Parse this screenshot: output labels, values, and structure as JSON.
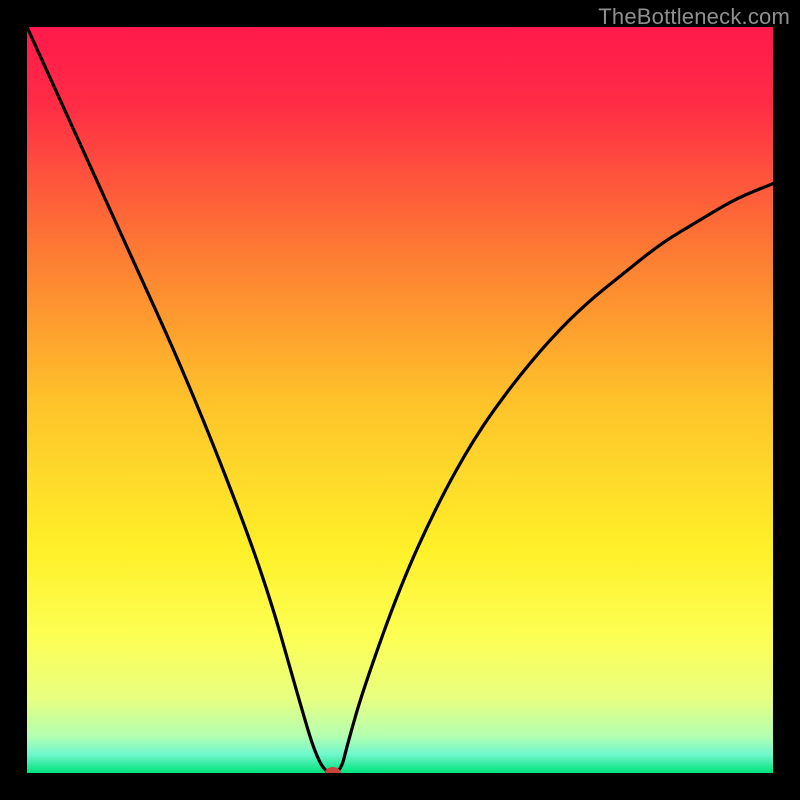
{
  "watermark": "TheBottleneck.com",
  "chart_data": {
    "type": "line",
    "title": "",
    "xlabel": "",
    "ylabel": "",
    "xlim": [
      0,
      100
    ],
    "ylim": [
      0,
      100
    ],
    "grid": false,
    "legend": false,
    "background": {
      "type": "vertical-gradient",
      "stops": [
        {
          "pos": 0.0,
          "color": "#ff1a4b"
        },
        {
          "pos": 0.1,
          "color": "#ff2b46"
        },
        {
          "pos": 0.3,
          "color": "#fd7a33"
        },
        {
          "pos": 0.5,
          "color": "#fec22a"
        },
        {
          "pos": 0.7,
          "color": "#fff029"
        },
        {
          "pos": 0.82,
          "color": "#fcff55"
        },
        {
          "pos": 0.9,
          "color": "#e8ff80"
        },
        {
          "pos": 0.95,
          "color": "#b4ffb0"
        },
        {
          "pos": 0.975,
          "color": "#70f7cd"
        },
        {
          "pos": 1.0,
          "color": "#00e27a"
        }
      ]
    },
    "series": [
      {
        "name": "bottleneck-curve",
        "color": "#000000",
        "x": [
          0,
          5,
          10,
          15,
          20,
          25,
          30,
          33,
          35,
          37,
          38.5,
          40,
          42,
          43,
          45,
          50,
          55,
          60,
          65,
          70,
          75,
          80,
          85,
          90,
          95,
          100
        ],
        "y": [
          100,
          89,
          78,
          67,
          56,
          44,
          31,
          22,
          15,
          8,
          3,
          0,
          0,
          4,
          11,
          25,
          36,
          45,
          52,
          58,
          63,
          67,
          71,
          74,
          77,
          79
        ]
      }
    ],
    "marker": {
      "x": 41,
      "y": 0,
      "color": "#c7473f",
      "rx": 8,
      "ry": 6
    },
    "notes": "Axes are unlabeled in the source image; values on implied 0–100 percent scales. Curve plunges from (0,100) to a flat minimum of 0 near x≈39–42, then rises asymptotically toward ~79 at x=100."
  }
}
